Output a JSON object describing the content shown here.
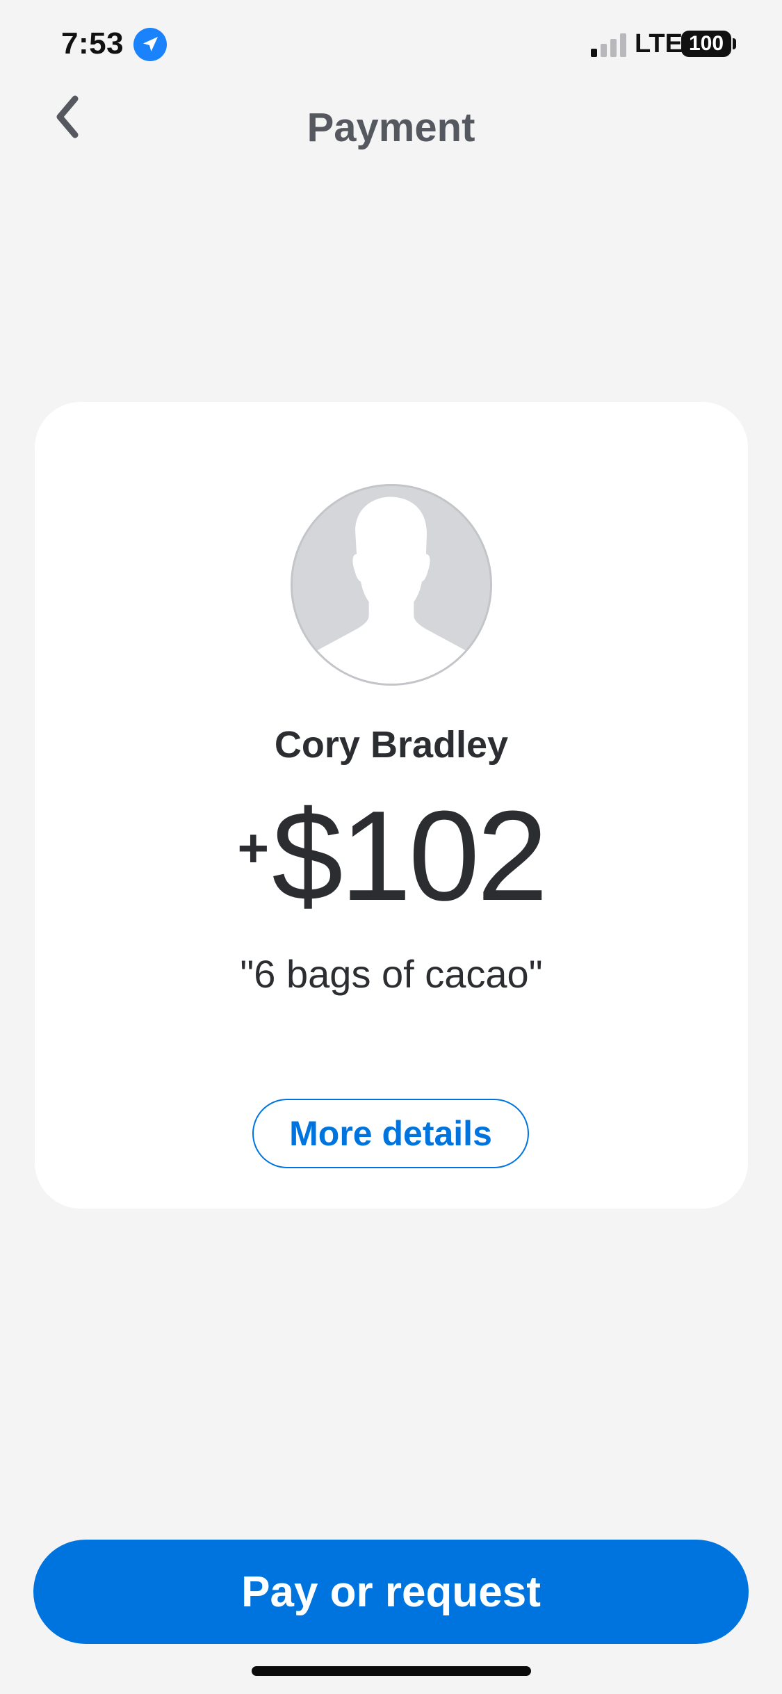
{
  "status_bar": {
    "time": "7:53",
    "location_icon": "location-arrow-icon",
    "signal_icon": "cellular-signal-icon",
    "signal_bars_active": 1,
    "signal_bars_total": 4,
    "network": "LTE",
    "battery": "100"
  },
  "header": {
    "back_icon": "chevron-left-icon",
    "title": "Payment"
  },
  "card": {
    "avatar_icon": "default-avatar-icon",
    "name": "Cory Bradley",
    "amount_sign": "+",
    "amount": "$102",
    "note": "\"6 bags of cacao\"",
    "more_details_label": "More details"
  },
  "footer": {
    "primary_button_label": "Pay or request"
  },
  "colors": {
    "accent": "#0074de",
    "background": "#f4f4f5",
    "card": "#ffffff",
    "text": "#2b2d31",
    "title": "#55585e",
    "location_badge": "#1a82fb"
  }
}
